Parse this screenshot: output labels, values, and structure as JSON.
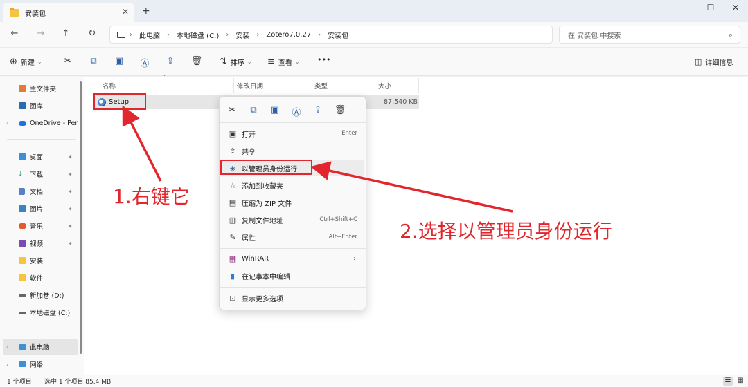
{
  "window": {
    "tab_title": "安装包",
    "tab_close": "✕",
    "new_tab": "+",
    "minimize": "—",
    "maximize": "☐",
    "close": "✕"
  },
  "nav": {
    "back": "←",
    "forward": "→",
    "up": "↑",
    "refresh": "↻"
  },
  "breadcrumb": [
    "此电脑",
    "本地磁盘 (C:)",
    "安装",
    "Zotero7.0.27",
    "安装包"
  ],
  "breadcrumb_sep": "›",
  "search": {
    "placeholder": "在 安装包 中搜索",
    "icon": "⌕"
  },
  "commands": {
    "new_label": "新建",
    "sort_label": "排序",
    "view_label": "查看",
    "more": "•••",
    "details_label": "详细信息"
  },
  "sidebar": {
    "items": [
      {
        "label": "主文件夹",
        "icon": "home-icon",
        "color": "#e07b39"
      },
      {
        "label": "图库",
        "icon": "gallery-icon",
        "color": "#2b6cb0"
      },
      {
        "label": "OneDrive - Per",
        "icon": "cloud-icon",
        "color": "#1a73e8"
      },
      {
        "label": "桌面",
        "icon": "desktop-icon",
        "color": "#3d8fd6"
      },
      {
        "label": "下载",
        "icon": "download-icon",
        "color": "#2e9e5b"
      },
      {
        "label": "文档",
        "icon": "document-icon",
        "color": "#5b7fc4"
      },
      {
        "label": "图片",
        "icon": "pictures-icon",
        "color": "#3b82c4"
      },
      {
        "label": "音乐",
        "icon": "music-icon",
        "color": "#e05a33"
      },
      {
        "label": "视频",
        "icon": "video-icon",
        "color": "#7b4bb3"
      },
      {
        "label": "安装",
        "icon": "folder-icon",
        "color": "#f5c542"
      },
      {
        "label": "软件",
        "icon": "folder-icon",
        "color": "#f5c542"
      },
      {
        "label": "新加卷 (D:)",
        "icon": "drive-icon",
        "color": "#666666"
      },
      {
        "label": "本地磁盘 (C:)",
        "icon": "drive-icon",
        "color": "#666666"
      },
      {
        "label": "此电脑",
        "icon": "pc-icon",
        "color": "#3d8fd6"
      },
      {
        "label": "网络",
        "icon": "network-icon",
        "color": "#3d8fd6"
      }
    ],
    "pin": "📌",
    "chevron": "›"
  },
  "columns": {
    "name": "名称",
    "modified": "修改日期",
    "type": "类型",
    "size": "大小"
  },
  "file": {
    "name": "Setup",
    "size": "87,540 KB"
  },
  "context_menu": {
    "items": [
      {
        "label": "打开",
        "shortcut": "Enter",
        "icon": "▣"
      },
      {
        "label": "共享",
        "shortcut": "",
        "icon": "⇪"
      },
      {
        "label": "以管理员身份运行",
        "shortcut": "",
        "icon": "◈"
      },
      {
        "label": "添加到收藏夹",
        "shortcut": "",
        "icon": "☆"
      },
      {
        "label": "压缩为 ZIP 文件",
        "shortcut": "",
        "icon": "▤"
      },
      {
        "label": "复制文件地址",
        "shortcut": "Ctrl+Shift+C",
        "icon": "▥"
      },
      {
        "label": "属性",
        "shortcut": "Alt+Enter",
        "icon": "✎"
      },
      {
        "label": "WinRAR",
        "shortcut": "",
        "icon": "▦"
      },
      {
        "label": "在记事本中编辑",
        "shortcut": "",
        "icon": "▮"
      },
      {
        "label": "显示更多选项",
        "shortcut": "",
        "icon": "⊡"
      }
    ],
    "submenu_arrow": "›"
  },
  "status": {
    "count": "1 个项目",
    "selected": "选中 1 个项目 85.4 MB"
  },
  "annotations": {
    "step1": "1.右键它",
    "step2": "2.选择以管理员身份运行"
  },
  "colors": {
    "annotation_red": "#e1262d",
    "accent_blue": "#2d5fa6"
  }
}
